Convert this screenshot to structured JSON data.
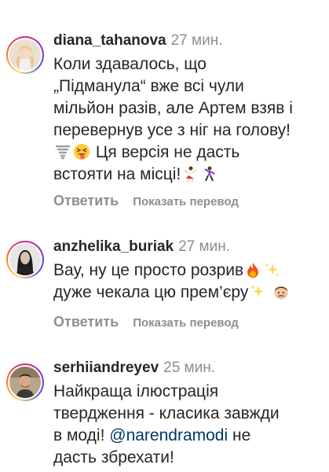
{
  "comments": [
    {
      "username": "diana_tahanova",
      "time": "27 мин.",
      "text_lines": [
        "Коли здавалось, що",
        "„Підманула“ вже всі чули",
        "мільйон разів, але Артем взяв і",
        "перевернув усе з ніг на голову!",
        "Ця версія не дасть",
        "встояти на місці!"
      ],
      "reply_label": "Ответить",
      "translate_label": "Показать перевод"
    },
    {
      "username": "anzhelika_buriak",
      "time": "27 мин.",
      "text_lines": [
        "Вау, ну це просто розрив",
        "дуже чекала цю прем’єру"
      ],
      "reply_label": "Ответить",
      "translate_label": "Показать перевод"
    },
    {
      "username": "serhiiandreyev",
      "time": "25 мин.",
      "text_lines": [
        "Найкраща ілюстрація",
        "твердження - класика завжди",
        "в моді!",
        "не",
        "дасть збрехати!"
      ],
      "mention": "@narendramodi"
    }
  ]
}
